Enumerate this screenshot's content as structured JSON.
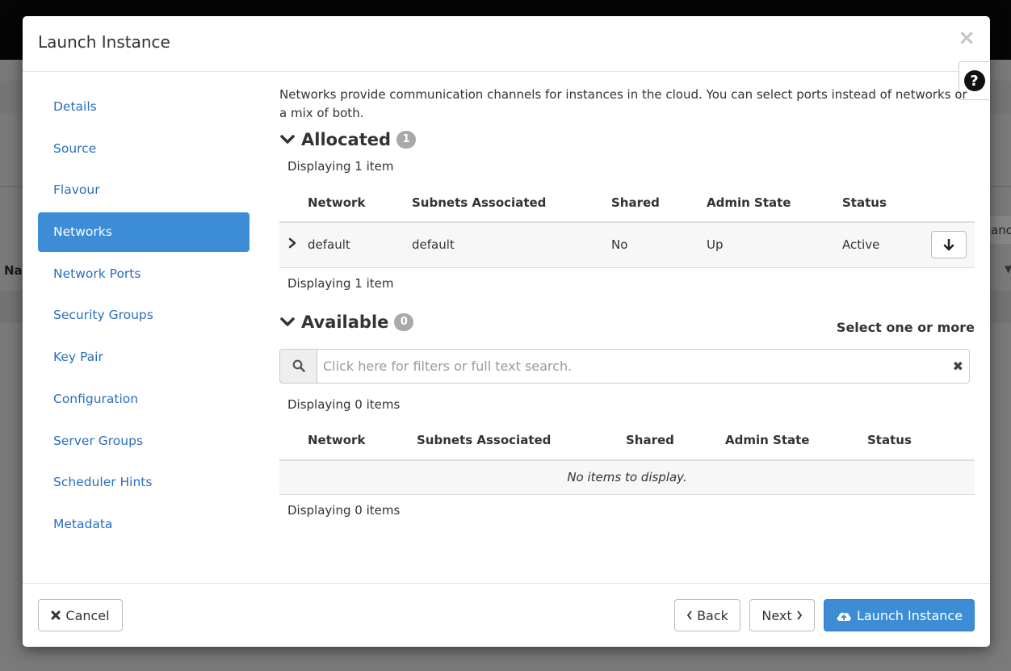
{
  "background": {
    "column_name": "Nar",
    "button_label": "anc"
  },
  "modal": {
    "title": "Launch Instance",
    "close_glyph": "×",
    "help_glyph": "?"
  },
  "sidebar": {
    "items": [
      {
        "label": "Details",
        "active": false
      },
      {
        "label": "Source",
        "active": false
      },
      {
        "label": "Flavour",
        "active": false
      },
      {
        "label": "Networks",
        "active": true
      },
      {
        "label": "Network Ports",
        "active": false
      },
      {
        "label": "Security Groups",
        "active": false
      },
      {
        "label": "Key Pair",
        "active": false
      },
      {
        "label": "Configuration",
        "active": false
      },
      {
        "label": "Server Groups",
        "active": false
      },
      {
        "label": "Scheduler Hints",
        "active": false
      },
      {
        "label": "Metadata",
        "active": false
      }
    ]
  },
  "main": {
    "intro": "Networks provide communication channels for instances in the cloud. You can select ports instead of networks or a mix of both.",
    "allocated": {
      "title": "Allocated",
      "count": "1",
      "displaying_top": "Displaying 1 item",
      "displaying_bottom": "Displaying 1 item",
      "columns": [
        "Network",
        "Subnets Associated",
        "Shared",
        "Admin State",
        "Status"
      ],
      "rows": [
        {
          "toggle": "›",
          "network": "default",
          "subnets": "default",
          "shared": "No",
          "admin_state": "Up",
          "status": "Active"
        }
      ]
    },
    "available": {
      "title": "Available",
      "count": "0",
      "select_note": "Select one or more",
      "search_placeholder": "Click here for filters or full text search.",
      "displaying_top": "Displaying 0 items",
      "displaying_bottom": "Displaying 0 items",
      "columns": [
        "Network",
        "Subnets Associated",
        "Shared",
        "Admin State",
        "Status"
      ],
      "empty_message": "No items to display."
    }
  },
  "footer": {
    "cancel_label": "Cancel",
    "back_label": "Back",
    "next_label": "Next",
    "launch_label": "Launch Instance"
  },
  "colors": {
    "accent": "#3c8dd5",
    "link": "#2a6ebb"
  },
  "icons": {
    "close": "close-icon",
    "help": "question-circle-icon",
    "search": "search-icon",
    "clear": "times-icon",
    "down": "arrow-down-icon",
    "cancel": "times-icon",
    "back": "chevron-left-icon",
    "next": "chevron-right-icon",
    "launch": "cloud-upload-icon"
  }
}
